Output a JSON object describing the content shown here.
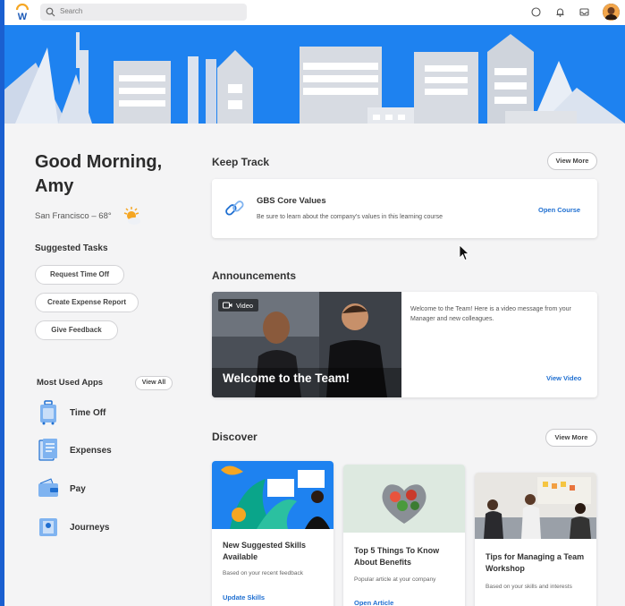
{
  "brand": {
    "logo_letter": "W",
    "accent": "#1e82f0",
    "blue_link": "#1f6fd1"
  },
  "search": {
    "placeholder": "Search"
  },
  "topbar_icons": [
    "chat-icon",
    "bell-icon",
    "inbox-icon"
  ],
  "greeting": {
    "text": "Good Morning, Amy",
    "weather": "San Francisco – 68°"
  },
  "suggested_tasks": {
    "title": "Suggested Tasks",
    "items": [
      "Request Time Off",
      "Create Expense Report",
      "Give Feedback"
    ]
  },
  "most_used_apps": {
    "title": "Most Used Apps",
    "view_all": "View All",
    "items": [
      "Time Off",
      "Expenses",
      "Pay",
      "Journeys"
    ]
  },
  "keep_track": {
    "title": "Keep Track",
    "view_more": "View More",
    "card": {
      "title": "GBS Core Values",
      "desc": "Be sure to learn about the company's values in this learning course",
      "action": "Open Course"
    }
  },
  "announcements": {
    "title": "Announcements",
    "card": {
      "badge": "Video",
      "overlay_title": "Welcome to the Team!",
      "desc": "Welcome to the Team! Here is a video message from your Manager and new colleagues.",
      "action": "View Video"
    }
  },
  "discover": {
    "title": "Discover",
    "view_more": "View More",
    "cards": [
      {
        "title": "New Suggested Skills Available",
        "desc": "Based on your recent feedback",
        "action": "Update Skills"
      },
      {
        "title": "Top 5 Things To Know About Benefits",
        "desc": "Popular article at your company",
        "action": "Open Article"
      },
      {
        "title": "Tips for Managing a Team Workshop",
        "desc": "Based on your skills and interests",
        "action": ""
      }
    ]
  }
}
